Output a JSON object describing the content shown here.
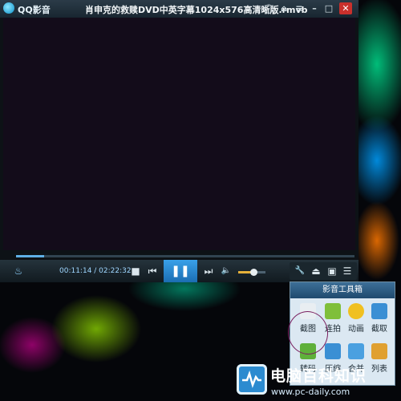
{
  "player": {
    "app_name": "QQ影音",
    "file_title": "肖申克的救赎DVD中英字幕1024x576高清晰版.rmvb",
    "title_buttons": [
      {
        "name": "mini-mode",
        "icon": "chat-bubble-icon",
        "glyph": "◯"
      },
      {
        "name": "skin",
        "icon": "shirt-icon",
        "glyph": "⌂"
      },
      {
        "name": "menu",
        "icon": "menu-icon",
        "glyph": "≡"
      },
      {
        "name": "minimize",
        "icon": "minimize-icon",
        "glyph": "–"
      },
      {
        "name": "maximize",
        "icon": "maximize-icon",
        "glyph": "□"
      },
      {
        "name": "close",
        "icon": "close-icon",
        "glyph": "✕"
      }
    ],
    "progress": 0.084,
    "time": "00:11:14 / 02:22:32",
    "volume": 0.55,
    "controls": {
      "footprint": "♨",
      "stop": "■",
      "prev": "⏮",
      "pause": "❚❚",
      "next": "⏭",
      "volume": "🔈",
      "settings": "🔧",
      "eject": "⏏",
      "fullscreen": "▣",
      "playlist": "☰"
    }
  },
  "toolbox": {
    "title": "影音工具箱",
    "tools": [
      {
        "label": "截图",
        "icon": "camera-icon",
        "color": "#e9eef2"
      },
      {
        "label": "连拍",
        "icon": "grid-icon",
        "color": "#7fbf3a"
      },
      {
        "label": "动画",
        "icon": "smiley-icon",
        "color": "#f0c020"
      },
      {
        "label": "截取",
        "icon": "film-icon",
        "color": "#3a8fd4"
      },
      {
        "label": "转码",
        "icon": "arrow-icon",
        "color": "#5fb03a"
      },
      {
        "label": "压缩",
        "icon": "compress-icon",
        "color": "#3a8fd4"
      },
      {
        "label": "合并",
        "icon": "merge-icon",
        "color": "#4aa0e0"
      },
      {
        "label": "列表",
        "icon": "list-icon",
        "color": "#e0a030"
      }
    ]
  },
  "watermark": {
    "brand": "电脑百科知识",
    "url": "www.pc-daily.com"
  }
}
